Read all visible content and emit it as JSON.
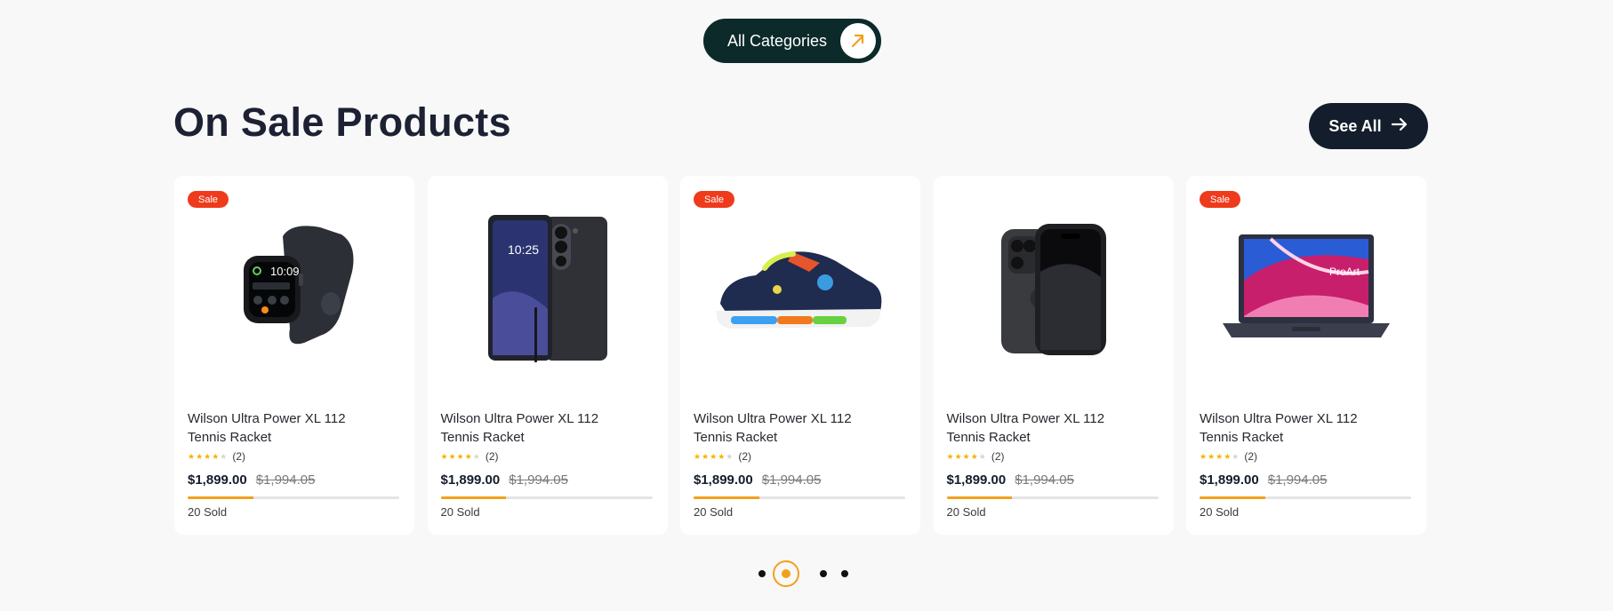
{
  "top_button": {
    "label": "All Categories",
    "icon": "arrow-up-right-icon"
  },
  "section": {
    "title": "On Sale Products",
    "see_all_label": "See All",
    "see_all_icon": "arrow-right-icon"
  },
  "products": [
    {
      "badge": "Sale",
      "image": "smartwatch",
      "name": "Wilson Ultra Power XL 112 Tennis Racket",
      "rating": 4,
      "reviews": "(2)",
      "price": "$1,899.00",
      "old_price": "$1,994.05",
      "sold_progress": 0.31,
      "sold": "20 Sold"
    },
    {
      "badge": "",
      "image": "smartphone",
      "name": "Wilson Ultra Power XL 112 Tennis Racket",
      "rating": 4,
      "reviews": "(2)",
      "price": "$1,899.00",
      "old_price": "$1,994.05",
      "sold_progress": 0.31,
      "sold": "20 Sold"
    },
    {
      "badge": "Sale",
      "image": "sneaker",
      "name": "Wilson Ultra Power XL 112 Tennis Racket",
      "rating": 4,
      "reviews": "(2)",
      "price": "$1,899.00",
      "old_price": "$1,994.05",
      "sold_progress": 0.31,
      "sold": "20 Sold"
    },
    {
      "badge": "",
      "image": "iphone",
      "name": "Wilson Ultra Power XL 112 Tennis Racket",
      "rating": 4,
      "reviews": "(2)",
      "price": "$1,899.00",
      "old_price": "$1,994.05",
      "sold_progress": 0.31,
      "sold": "20 Sold"
    },
    {
      "badge": "Sale",
      "image": "laptop",
      "name": "Wilson Ultra Power XL 112 Tennis Racket",
      "rating": 4,
      "reviews": "(2)",
      "price": "$1,899.00",
      "old_price": "$1,994.05",
      "sold_progress": 0.31,
      "sold": "20 Sold",
      "laptop_brand": "ProArt"
    }
  ],
  "pagination": {
    "count": 4,
    "active": 1
  },
  "colors": {
    "accent": "#f2a01c",
    "sale": "#ee3b1c",
    "dark": "#141d2b",
    "category_button": "#0c2a2a"
  }
}
